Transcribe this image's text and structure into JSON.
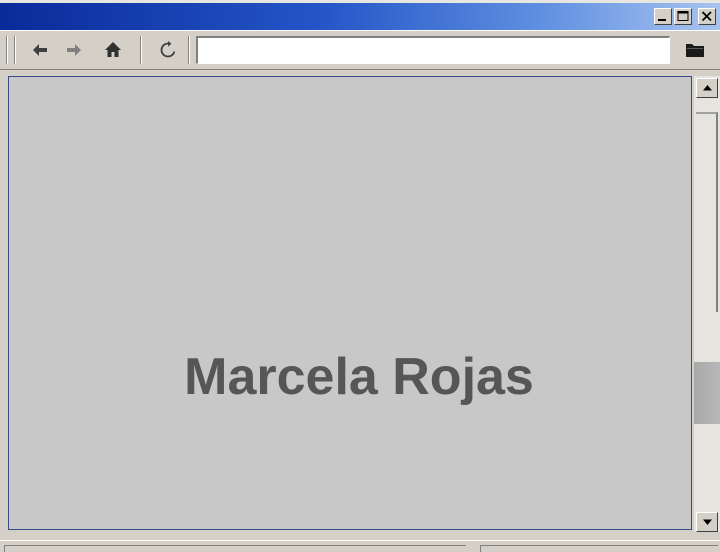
{
  "window": {
    "title": "",
    "controls": {
      "minimize_icon": "minimize-icon",
      "maximize_icon": "maximize-icon",
      "close_icon": "close-icon"
    },
    "colors": {
      "titlebar_start": "#0a2a9a",
      "titlebar_end": "#a8c4f0",
      "chrome": "#d4d0c8",
      "content_bg": "#c8c8c8",
      "headline": "#565656"
    }
  },
  "toolbar": {
    "back_icon": "arrow-left-icon",
    "forward_icon": "arrow-right-icon",
    "home_icon": "home-icon",
    "refresh_icon": "refresh-icon",
    "folder_icon": "folder-icon",
    "address": {
      "value": "",
      "placeholder": ""
    }
  },
  "content": {
    "headline": "Marcela Rojas"
  },
  "scrollbar": {
    "up_icon": "scroll-up-arrow-icon",
    "down_icon": "scroll-down-arrow-icon"
  },
  "statusbar": {
    "text": "",
    "zone": ""
  }
}
